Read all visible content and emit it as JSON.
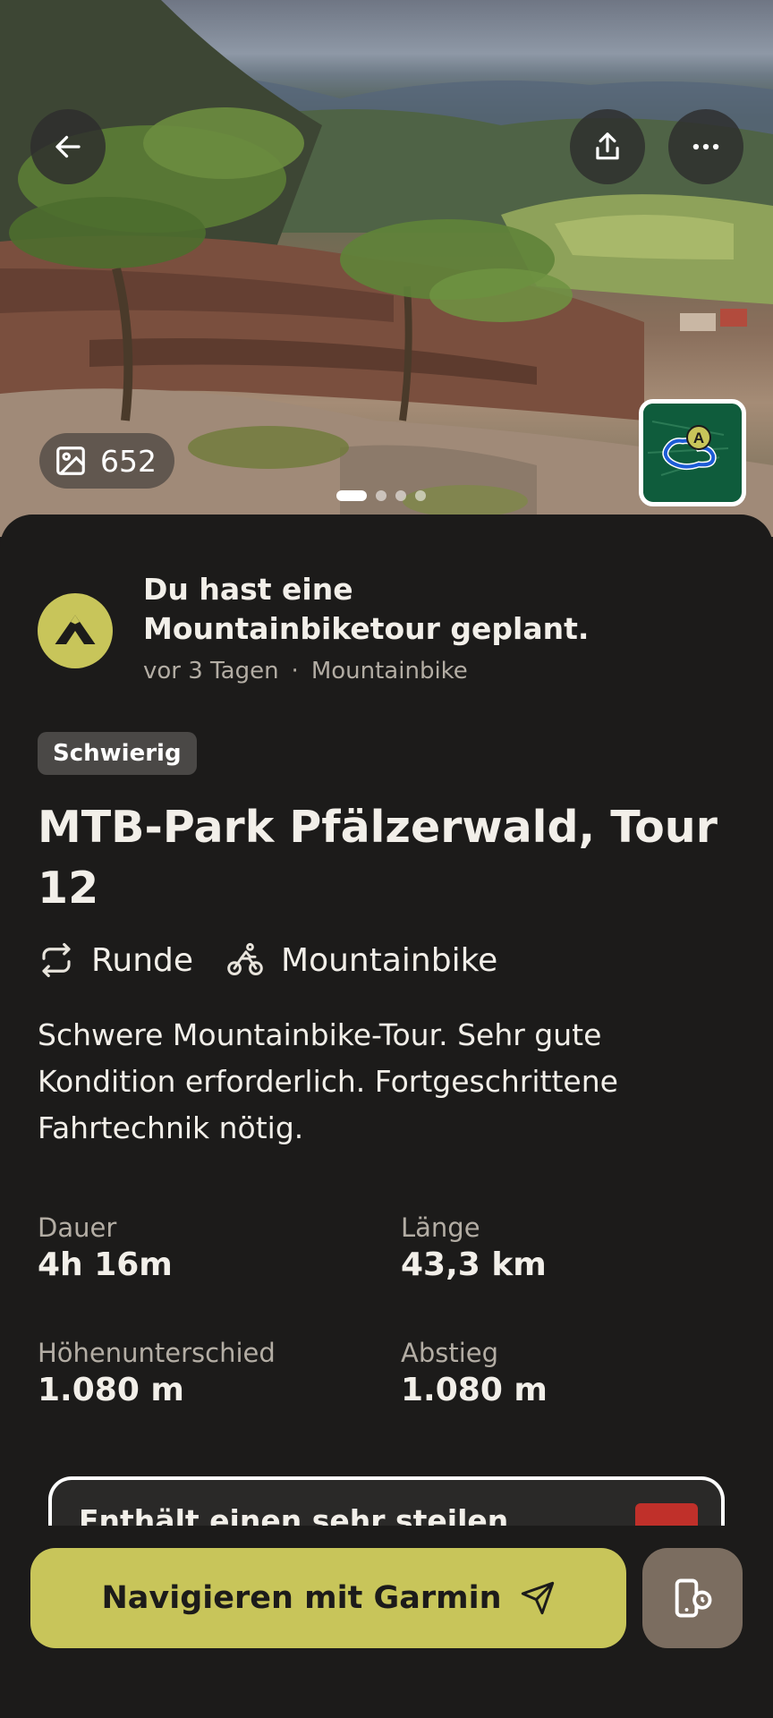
{
  "hero": {
    "photo_count": "652",
    "carousel_dots": 4,
    "active_dot": 0
  },
  "activity": {
    "title": "Du hast eine Mountainbiketour geplant.",
    "time": "vor 3 Tagen",
    "separator": "·",
    "sport": "Mountainbike"
  },
  "tour": {
    "difficulty": "Schwierig",
    "title": "MTB-Park Pfälzerwald, Tour 12",
    "type": "Runde",
    "sport": "Mountainbike",
    "description": "Schwere Mountainbike-Tour. Sehr gute Kondition erforderlich. Fortgeschrittene Fahrtechnik nötig."
  },
  "stats": {
    "duration_label": "Dauer",
    "duration_value": "4h 16m",
    "length_label": "Länge",
    "length_value": "43,3 km",
    "elevation_label": "Höhenunterschied",
    "elevation_value": "1.080 m",
    "descent_label": "Abstieg",
    "descent_value": "1.080 m"
  },
  "card_peek": {
    "text": "Enthält einen sehr steilen"
  },
  "map_marker": "A",
  "bottom": {
    "navigate_label": "Navigieren mit Garmin"
  },
  "colors": {
    "accent": "#c8c55a",
    "background": "#1c1b1a",
    "device_button": "#7b6d60"
  }
}
